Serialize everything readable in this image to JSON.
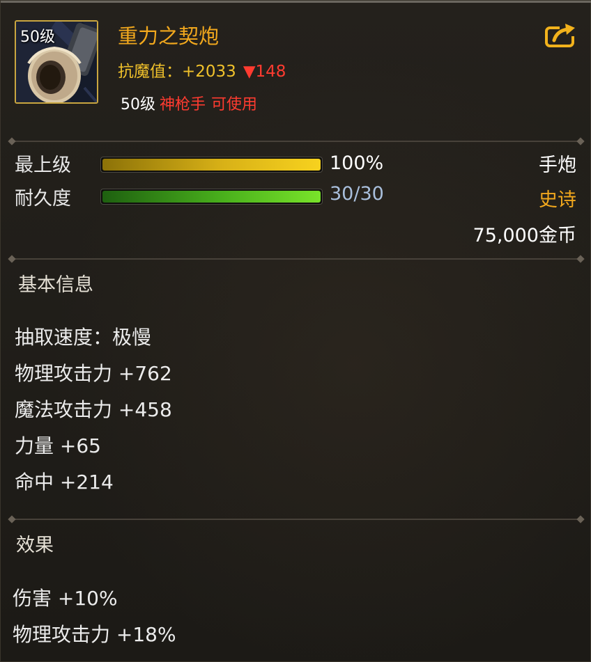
{
  "item": {
    "level_badge": "50级",
    "name": "重力之契炮",
    "resist_label": "抗魔值：+2033",
    "resist_delta": "▼148",
    "req_level": "50级",
    "req_class": "神枪手",
    "req_usable": "可使用"
  },
  "icons": {
    "item": "cannon-item-icon",
    "share": "share-icon"
  },
  "bars": {
    "upgrade_label": "最上级",
    "upgrade_value": "100%",
    "upgrade_fraction": 1.0,
    "durability_label": "耐久度",
    "durability_value": "30/30",
    "durability_fraction": 1.0
  },
  "info_right": {
    "type": "手炮",
    "rarity": "史诗",
    "price": "75,000金币"
  },
  "basic": {
    "title": "基本信息",
    "stats": [
      "抽取速度：极慢",
      "物理攻击力 +762",
      "魔法攻击力 +458",
      "力量 +65",
      "命中 +214"
    ]
  },
  "effects": {
    "title": "效果",
    "items": [
      "伤害 +10%",
      "物理攻击力 +18%"
    ]
  },
  "colors": {
    "name": "#f2a81d",
    "resist": "#f0c12b",
    "warning": "#ff3b30",
    "rarity": "#f2a81d",
    "durability_text": "#a9bfdc"
  }
}
